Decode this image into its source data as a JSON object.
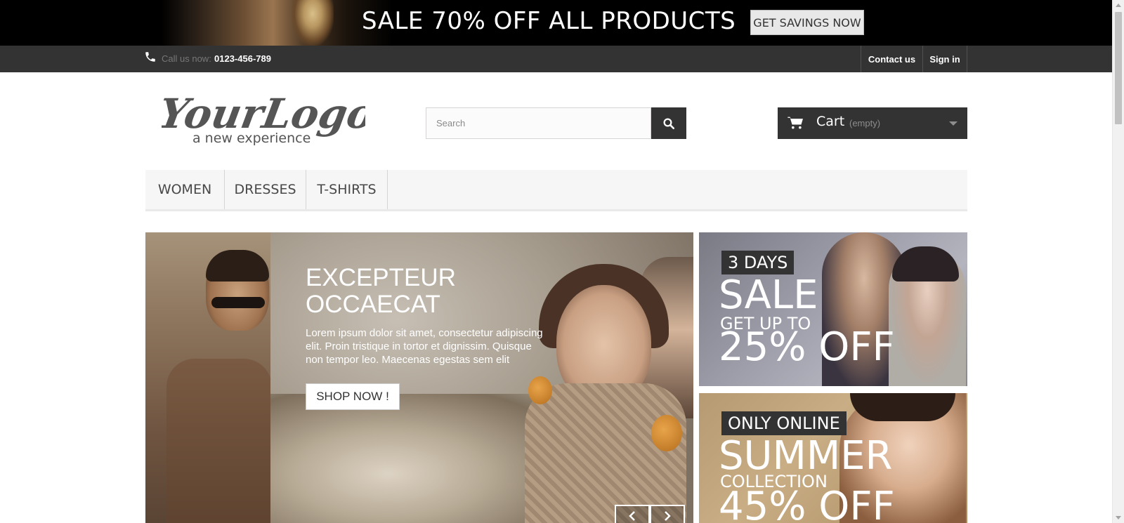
{
  "promo": {
    "headline": "SALE 70% OFF ALL PRODUCTS",
    "button_label": "GET SAVINGS NOW"
  },
  "topbar": {
    "call_label": "Call us now:",
    "phone": "0123-456-789",
    "links": [
      "Contact us",
      "Sign in"
    ]
  },
  "header": {
    "logo_main": "YourLogo",
    "logo_tagline": "a new experience",
    "search_placeholder": "Search",
    "search_value": "",
    "cart_label": "Cart",
    "cart_status": "(empty)"
  },
  "menu": {
    "items": [
      "WOMEN",
      "DRESSES",
      "T-SHIRTS"
    ]
  },
  "slider": {
    "title_line1": "EXCEPTEUR",
    "title_line2": "OCCAECAT",
    "text": "Lorem ipsum dolor sit amet, consectetur adipiscing elit. Proin tristique in tortor et dignissim. Quisque non tempor leo. Maecenas egestas sem elit",
    "button_label": "SHOP NOW !"
  },
  "banners": [
    {
      "tag": "3 DAYS",
      "big": "SALE",
      "small": "GET UP TO",
      "offer": "25% OFF"
    },
    {
      "tag": "ONLY ONLINE",
      "big": "SUMMER",
      "small": "COLLECTION",
      "offer": "45% OFF"
    }
  ],
  "colors": {
    "dark": "#333333",
    "promo_bg": "#000000",
    "menu_bg": "#f6f6f6"
  },
  "icons": {
    "phone": "phone-icon",
    "search": "search-icon",
    "cart": "cart-icon",
    "caret": "chevron-down-icon",
    "prev": "chevron-left-icon",
    "next": "chevron-right-icon"
  }
}
